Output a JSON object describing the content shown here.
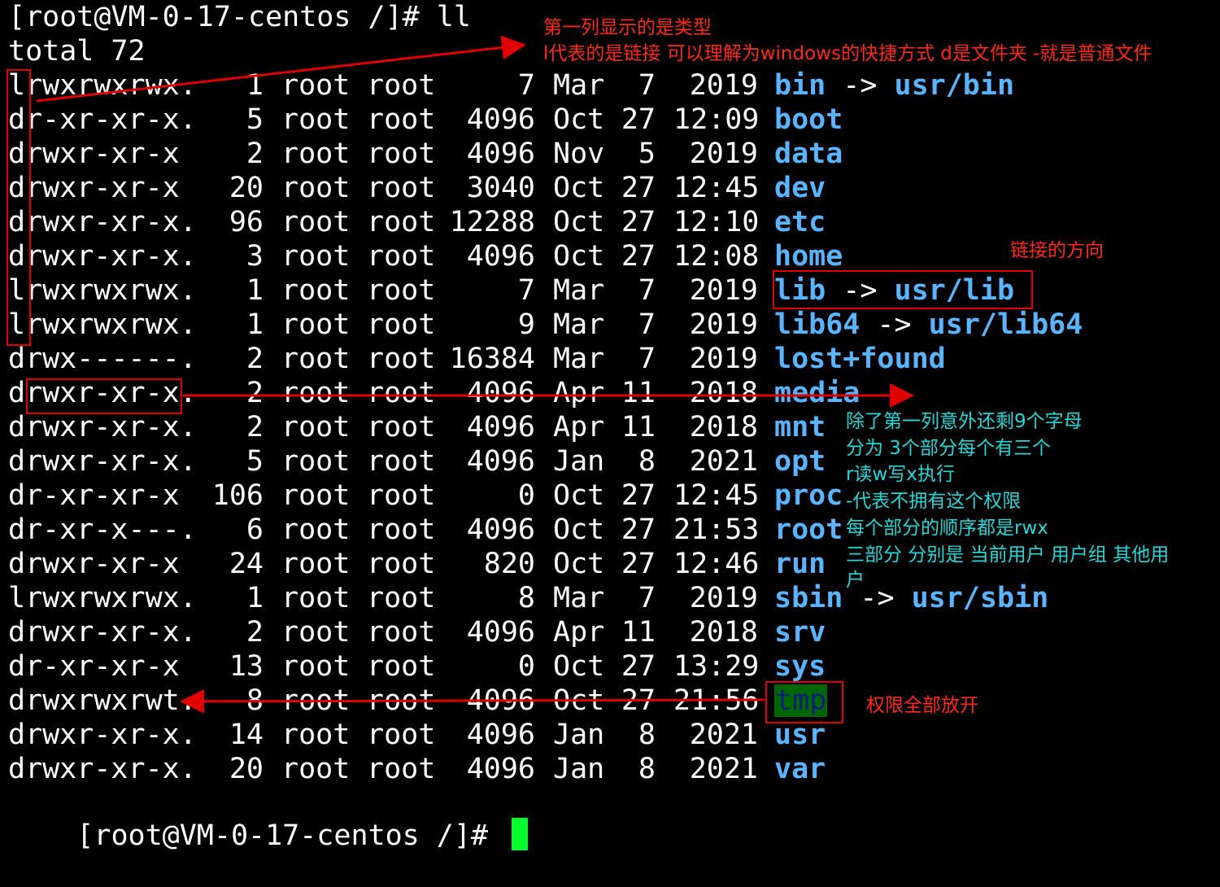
{
  "terminal": {
    "prompt_command": "[root@VM-0-17-centos /]# ll",
    "total_line": "total 72",
    "final_prompt": "[root@VM-0-17-centos /]# ",
    "rows": [
      {
        "perms": "lrwxrwxrwx.",
        "links": "1",
        "owner": "root",
        "group": "root",
        "size": "7",
        "month": "Mar",
        "day": "7",
        "time": "2019",
        "name": "bin",
        "arrow": " -> ",
        "target": "usr/bin"
      },
      {
        "perms": "dr-xr-xr-x.",
        "links": "5",
        "owner": "root",
        "group": "root",
        "size": "4096",
        "month": "Oct",
        "day": "27",
        "time": "12:09",
        "name": "boot",
        "arrow": "",
        "target": ""
      },
      {
        "perms": "drwxr-xr-x",
        "links": "2",
        "owner": "root",
        "group": "root",
        "size": "4096",
        "month": "Nov",
        "day": "5",
        "time": "2019",
        "name": "data",
        "arrow": "",
        "target": ""
      },
      {
        "perms": "drwxr-xr-x",
        "links": "20",
        "owner": "root",
        "group": "root",
        "size": "3040",
        "month": "Oct",
        "day": "27",
        "time": "12:45",
        "name": "dev",
        "arrow": "",
        "target": ""
      },
      {
        "perms": "drwxr-xr-x.",
        "links": "96",
        "owner": "root",
        "group": "root",
        "size": "12288",
        "month": "Oct",
        "day": "27",
        "time": "12:10",
        "name": "etc",
        "arrow": "",
        "target": ""
      },
      {
        "perms": "drwxr-xr-x.",
        "links": "3",
        "owner": "root",
        "group": "root",
        "size": "4096",
        "month": "Oct",
        "day": "27",
        "time": "12:08",
        "name": "home",
        "arrow": "",
        "target": ""
      },
      {
        "perms": "lrwxrwxrwx.",
        "links": "1",
        "owner": "root",
        "group": "root",
        "size": "7",
        "month": "Mar",
        "day": "7",
        "time": "2019",
        "name": "lib",
        "arrow": " -> ",
        "target": "usr/lib"
      },
      {
        "perms": "lrwxrwxrwx.",
        "links": "1",
        "owner": "root",
        "group": "root",
        "size": "9",
        "month": "Mar",
        "day": "7",
        "time": "2019",
        "name": "lib64",
        "arrow": " -> ",
        "target": "usr/lib64"
      },
      {
        "perms": "drwx------.",
        "links": "2",
        "owner": "root",
        "group": "root",
        "size": "16384",
        "month": "Mar",
        "day": "7",
        "time": "2019",
        "name": "lost+found",
        "arrow": "",
        "target": ""
      },
      {
        "perms": "drwxr-xr-x.",
        "links": "2",
        "owner": "root",
        "group": "root",
        "size": "4096",
        "month": "Apr",
        "day": "11",
        "time": "2018",
        "name": "media",
        "arrow": "",
        "target": ""
      },
      {
        "perms": "drwxr-xr-x.",
        "links": "2",
        "owner": "root",
        "group": "root",
        "size": "4096",
        "month": "Apr",
        "day": "11",
        "time": "2018",
        "name": "mnt",
        "arrow": "",
        "target": ""
      },
      {
        "perms": "drwxr-xr-x.",
        "links": "5",
        "owner": "root",
        "group": "root",
        "size": "4096",
        "month": "Jan",
        "day": "8",
        "time": "2021",
        "name": "opt",
        "arrow": "",
        "target": ""
      },
      {
        "perms": "dr-xr-xr-x",
        "links": "106",
        "owner": "root",
        "group": "root",
        "size": "0",
        "month": "Oct",
        "day": "27",
        "time": "12:45",
        "name": "proc",
        "arrow": "",
        "target": ""
      },
      {
        "perms": "dr-xr-x---.",
        "links": "6",
        "owner": "root",
        "group": "root",
        "size": "4096",
        "month": "Oct",
        "day": "27",
        "time": "21:53",
        "name": "root",
        "arrow": "",
        "target": ""
      },
      {
        "perms": "drwxr-xr-x",
        "links": "24",
        "owner": "root",
        "group": "root",
        "size": "820",
        "month": "Oct",
        "day": "27",
        "time": "12:46",
        "name": "run",
        "arrow": "",
        "target": ""
      },
      {
        "perms": "lrwxrwxrwx.",
        "links": "1",
        "owner": "root",
        "group": "root",
        "size": "8",
        "month": "Mar",
        "day": "7",
        "time": "2019",
        "name": "sbin",
        "arrow": " -> ",
        "target": "usr/sbin"
      },
      {
        "perms": "drwxr-xr-x.",
        "links": "2",
        "owner": "root",
        "group": "root",
        "size": "4096",
        "month": "Apr",
        "day": "11",
        "time": "2018",
        "name": "srv",
        "arrow": "",
        "target": ""
      },
      {
        "perms": "dr-xr-xr-x",
        "links": "13",
        "owner": "root",
        "group": "root",
        "size": "0",
        "month": "Oct",
        "day": "27",
        "time": "13:29",
        "name": "sys",
        "arrow": "",
        "target": ""
      },
      {
        "perms": "drwxrwxrwt.",
        "links": "8",
        "owner": "root",
        "group": "root",
        "size": "4096",
        "month": "Oct",
        "day": "27",
        "time": "21:56",
        "name": "tmp",
        "arrow": "",
        "target": ""
      },
      {
        "perms": "drwxr-xr-x.",
        "links": "14",
        "owner": "root",
        "group": "root",
        "size": "4096",
        "month": "Jan",
        "day": "8",
        "time": "2021",
        "name": "usr",
        "arrow": "",
        "target": ""
      },
      {
        "perms": "drwxr-xr-x.",
        "links": "20",
        "owner": "root",
        "group": "root",
        "size": "4096",
        "month": "Jan",
        "day": "8",
        "time": "2021",
        "name": "var",
        "arrow": "",
        "target": ""
      }
    ]
  },
  "annotations": {
    "type_line1": "第一列显示的是类型",
    "type_line2": "l代表的是链接 可以理解为windows的快捷方式 d是文件夹 -就是普通文件",
    "link_direction": "链接的方向",
    "perm_1": "除了第一列意外还剩9个字母",
    "perm_2": "分为 3个部分每个有三个",
    "perm_3": "r读w写x执行",
    "perm_4": "-代表不拥有这个权限",
    "perm_5": "每个部分的顺序都是rwx",
    "perm_6": "三部分 分别是 当前用户 用户组 其他用",
    "perm_7": "户",
    "all_open": "权限全部放开"
  },
  "colors": {
    "background": "#000000",
    "text": "#ffffff",
    "dir_name": "#5ab4ff",
    "annotation_red": "#ff2a1a",
    "annotation_cyan": "#27d6d6",
    "cursor": "#00ff2a"
  }
}
